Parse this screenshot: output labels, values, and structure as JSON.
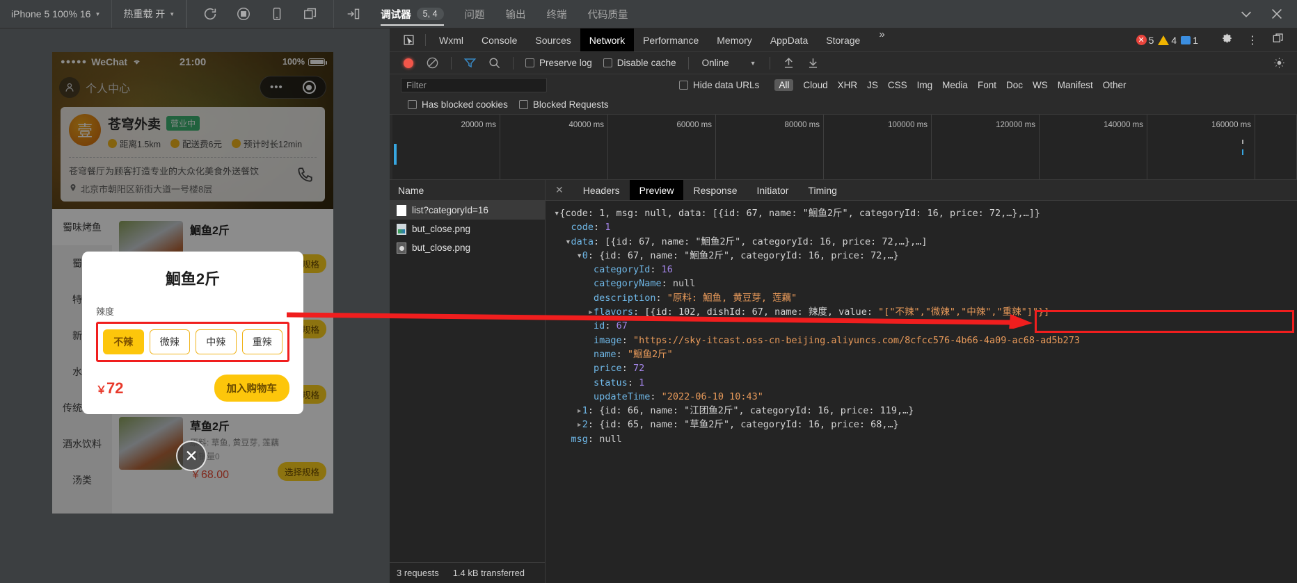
{
  "topbar": {
    "device": "iPhone 5 100% 16",
    "hot_reload": "热重载 开",
    "icons": [
      "refresh-icon",
      "stop-icon",
      "phone-icon",
      "split-icon"
    ],
    "panel_toggle": "toggle-panel-icon",
    "tabs": [
      {
        "label": "调试器",
        "badge": "5, 4",
        "active": true
      },
      {
        "label": "问题",
        "badge": "",
        "active": false
      },
      {
        "label": "输出",
        "badge": "",
        "active": false
      },
      {
        "label": "终端",
        "badge": "",
        "active": false
      },
      {
        "label": "代码质量",
        "badge": "",
        "active": false
      }
    ],
    "collapse_icon": "chevron-down-icon",
    "close_icon": "close-icon"
  },
  "simulator": {
    "status": {
      "carrier": "WeChat",
      "dots": "●●●●●",
      "wifi": "wifi-icon",
      "time": "21:00",
      "battery": "100%"
    },
    "nav": {
      "user_label": "个人中心",
      "capsule_more": "•••",
      "capsule_target": "target-icon"
    },
    "shop": {
      "name": "苍穹外卖",
      "status_badge": "营业中",
      "meta": [
        "距离1.5km",
        "配送费6元",
        "预计时长12min"
      ],
      "description": "苍穹餐厅为顾客打造专业的大众化美食外送餐饮",
      "address": "北京市朝阳区新街大道一号楼8层",
      "phone_icon": "phone-call-icon"
    },
    "categories": [
      {
        "label": "蜀味烤鱼",
        "selected": true
      },
      {
        "label": "蜀味",
        "selected": false
      },
      {
        "label": "特色",
        "selected": false
      },
      {
        "label": "新鲜",
        "selected": false
      },
      {
        "label": "水煮",
        "selected": false
      },
      {
        "label": "传统主食",
        "selected": false
      },
      {
        "label": "酒水饮料",
        "selected": false
      },
      {
        "label": "汤类",
        "selected": false
      }
    ],
    "dishes": [
      {
        "name": "鮰鱼2斤",
        "desc": "",
        "sales": "",
        "price": "",
        "spec_btn": "规格"
      },
      {
        "name": "",
        "desc": "",
        "sales": "",
        "price": "",
        "spec_btn": "规格"
      },
      {
        "name": "",
        "desc": "",
        "sales": "",
        "price": "",
        "spec_btn": "规格"
      },
      {
        "name": "草鱼2斤",
        "desc": "原料: 草鱼, 黄豆芽, 莲藕",
        "sales": "月销量0",
        "price": "￥68.00",
        "spec_btn": "选择规格"
      }
    ],
    "modal": {
      "title": "鮰鱼2斤",
      "flavor_label": "辣度",
      "flavors": [
        {
          "label": "不辣",
          "selected": true
        },
        {
          "label": "微辣",
          "selected": false
        },
        {
          "label": "中辣",
          "selected": false
        },
        {
          "label": "重辣",
          "selected": false
        }
      ],
      "price": "72",
      "currency": "￥",
      "add_cart": "加入购物车",
      "close_icon": "close-icon"
    }
  },
  "devtools": {
    "panel_tabs": [
      {
        "label": "Wxml",
        "active": false
      },
      {
        "label": "Console",
        "active": false
      },
      {
        "label": "Sources",
        "active": false
      },
      {
        "label": "Network",
        "active": true
      },
      {
        "label": "Performance",
        "active": false
      },
      {
        "label": "Memory",
        "active": false
      },
      {
        "label": "AppData",
        "active": false
      },
      {
        "label": "Storage",
        "active": false
      }
    ],
    "more_icon": "chevron-double-right-icon",
    "counts": {
      "errors": "5",
      "warnings": "4",
      "messages": "1"
    },
    "settings_icon": "gear-icon",
    "kebab_icon": "more-vertical-icon",
    "dock_icon": "dock-icon",
    "inspect_icon": "inspect-cursor-icon",
    "toolbar": {
      "record_icon": "record-icon",
      "clear_icon": "clear-icon",
      "filter_icon": "filter-icon",
      "search_icon": "search-icon",
      "preserve_log": "Preserve log",
      "disable_cache": "Disable cache",
      "throttling": "Online",
      "upload_icon": "import-har-icon",
      "download_icon": "export-har-icon",
      "settings_icon": "network-settings-icon"
    },
    "filterbar": {
      "placeholder": "Filter",
      "hide_data_urls": "Hide data URLs",
      "types": [
        "All",
        "Cloud",
        "XHR",
        "JS",
        "CSS",
        "Img",
        "Media",
        "Font",
        "Doc",
        "WS",
        "Manifest",
        "Other"
      ],
      "active_type": "All"
    },
    "checkbar": {
      "has_blocked_cookies": "Has blocked cookies",
      "blocked_requests": "Blocked Requests"
    },
    "timeline": {
      "ticks": [
        "20000 ms",
        "40000 ms",
        "60000 ms",
        "80000 ms",
        "100000 ms",
        "120000 ms",
        "140000 ms",
        "160000 ms"
      ]
    },
    "requests": {
      "header": "Name",
      "rows": [
        {
          "name": "list?categoryId=16",
          "icon": "doc-icon",
          "selected": true
        },
        {
          "name": "but_close.png",
          "icon": "image-icon",
          "selected": false
        },
        {
          "name": "but_close.png",
          "icon": "image-dark-icon",
          "selected": false
        }
      ],
      "footer": {
        "requests": "3 requests",
        "transferred": "1.4 kB transferred"
      }
    },
    "detail_tabs": [
      {
        "label": "Headers",
        "active": false
      },
      {
        "label": "Preview",
        "active": true
      },
      {
        "label": "Response",
        "active": false
      },
      {
        "label": "Initiator",
        "active": false
      },
      {
        "label": "Timing",
        "active": false
      }
    ],
    "detail_close_icon": "close-icon",
    "preview": {
      "lines": [
        {
          "indent": 0,
          "tri": "down",
          "parts": [
            {
              "t": "{code: 1, msg: null, data: [{id: 67, name: \"鮰鱼2斤\", categoryId: 16, price: 72,…},…]}",
              "c": "pl"
            }
          ]
        },
        {
          "indent": 1,
          "tri": "",
          "parts": [
            {
              "t": "code",
              "c": "k"
            },
            {
              "t": ": ",
              "c": "pl"
            },
            {
              "t": "1",
              "c": "num"
            }
          ]
        },
        {
          "indent": 1,
          "tri": "down",
          "parts": [
            {
              "t": "data",
              "c": "k"
            },
            {
              "t": ": [{id: 67, name: \"鮰鱼2斤\", categoryId: 16, price: 72,…},…]",
              "c": "pl"
            }
          ]
        },
        {
          "indent": 2,
          "tri": "down",
          "parts": [
            {
              "t": "0",
              "c": "k"
            },
            {
              "t": ": {id: 67, name: \"鮰鱼2斤\", categoryId: 16, price: 72,…}",
              "c": "pl"
            }
          ]
        },
        {
          "indent": 3,
          "tri": "",
          "parts": [
            {
              "t": "categoryId",
              "c": "k"
            },
            {
              "t": ": ",
              "c": "pl"
            },
            {
              "t": "16",
              "c": "num"
            }
          ]
        },
        {
          "indent": 3,
          "tri": "",
          "parts": [
            {
              "t": "categoryName",
              "c": "k"
            },
            {
              "t": ": ",
              "c": "pl"
            },
            {
              "t": "null",
              "c": "nul"
            }
          ]
        },
        {
          "indent": 3,
          "tri": "",
          "parts": [
            {
              "t": "description",
              "c": "k"
            },
            {
              "t": ": ",
              "c": "pl"
            },
            {
              "t": "\"原料: 鮰鱼, 黄豆芽, 莲藕\"",
              "c": "str"
            }
          ]
        },
        {
          "indent": 3,
          "tri": "right",
          "parts": [
            {
              "t": "flavors",
              "c": "k"
            },
            {
              "t": ": [{id: 102, dishId: 67, name: ",
              "c": "pl"
            },
            {
              "t": "辣度",
              "c": "pl"
            },
            {
              "t": ", value: ",
              "c": "pl"
            },
            {
              "t": "\"[\"不辣\",\"微辣\",\"中辣\",\"重辣\"]\"}]",
              "c": "str"
            }
          ]
        },
        {
          "indent": 3,
          "tri": "",
          "parts": [
            {
              "t": "id",
              "c": "k"
            },
            {
              "t": ": ",
              "c": "pl"
            },
            {
              "t": "67",
              "c": "num"
            }
          ]
        },
        {
          "indent": 3,
          "tri": "",
          "parts": [
            {
              "t": "image",
              "c": "k"
            },
            {
              "t": ": ",
              "c": "pl"
            },
            {
              "t": "\"https://sky-itcast.oss-cn-beijing.aliyuncs.com/8cfcc576-4b66-4a09-ac68-ad5b273",
              "c": "str"
            }
          ]
        },
        {
          "indent": 3,
          "tri": "",
          "parts": [
            {
              "t": "name",
              "c": "k"
            },
            {
              "t": ": ",
              "c": "pl"
            },
            {
              "t": "\"鮰鱼2斤\"",
              "c": "str"
            }
          ]
        },
        {
          "indent": 3,
          "tri": "",
          "parts": [
            {
              "t": "price",
              "c": "k"
            },
            {
              "t": ": ",
              "c": "pl"
            },
            {
              "t": "72",
              "c": "num"
            }
          ]
        },
        {
          "indent": 3,
          "tri": "",
          "parts": [
            {
              "t": "status",
              "c": "k"
            },
            {
              "t": ": ",
              "c": "pl"
            },
            {
              "t": "1",
              "c": "num"
            }
          ]
        },
        {
          "indent": 3,
          "tri": "",
          "parts": [
            {
              "t": "updateTime",
              "c": "k"
            },
            {
              "t": ": ",
              "c": "pl"
            },
            {
              "t": "\"2022-06-10 10:43\"",
              "c": "str"
            }
          ]
        },
        {
          "indent": 2,
          "tri": "right",
          "parts": [
            {
              "t": "1",
              "c": "k"
            },
            {
              "t": ": {id: 66, name: \"江团鱼2斤\", categoryId: 16, price: 119,…}",
              "c": "pl"
            }
          ]
        },
        {
          "indent": 2,
          "tri": "right",
          "parts": [
            {
              "t": "2",
              "c": "k"
            },
            {
              "t": ": {id: 65, name: \"草鱼2斤\", categoryId: 16, price: 68,…}",
              "c": "pl"
            }
          ]
        },
        {
          "indent": 1,
          "tri": "",
          "parts": [
            {
              "t": "msg",
              "c": "k"
            },
            {
              "t": ": ",
              "c": "pl"
            },
            {
              "t": "null",
              "c": "nul"
            }
          ]
        }
      ]
    }
  },
  "annotation": {
    "color": "#f01e1e",
    "arrow_name": "red-arrow-annotation",
    "boxes": [
      "flavor-options-highlight",
      "flavors-value-highlight"
    ]
  }
}
